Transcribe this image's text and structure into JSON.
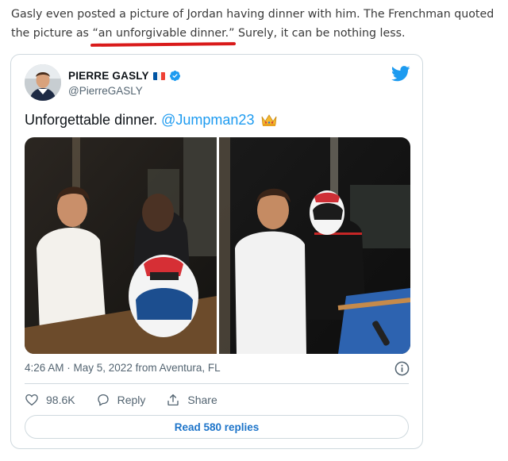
{
  "article": {
    "intro_before": "Gasly even posted a picture of Jordan having dinner with him. The Frenchman quoted the picture as ",
    "intro_quote": "“an unforgivable dinner.”",
    "intro_after": " Surely, it can be nothing less.",
    "underline_color": "#d91a1a"
  },
  "tweet": {
    "author_name": "PIERRE GASLY",
    "author_handle": "@PierreGASLY",
    "flag_colors": [
      "#0055a4",
      "#ffffff",
      "#ef4135"
    ],
    "text_before": "Unforgettable dinner. ",
    "mention": "@Jumpman23",
    "emoji": "crown",
    "timestamp": "4:26 AM · May 5, 2022 from Aventura, FL",
    "likes": "98.6K",
    "reply_label": "Reply",
    "share_label": "Share",
    "read_replies_label": "Read 580 replies",
    "icons": [
      "twitter-bird-icon",
      "verified-badge-icon",
      "info-icon",
      "heart-icon",
      "reply-icon",
      "share-icon"
    ],
    "accent_color": "#1d9bf0"
  }
}
